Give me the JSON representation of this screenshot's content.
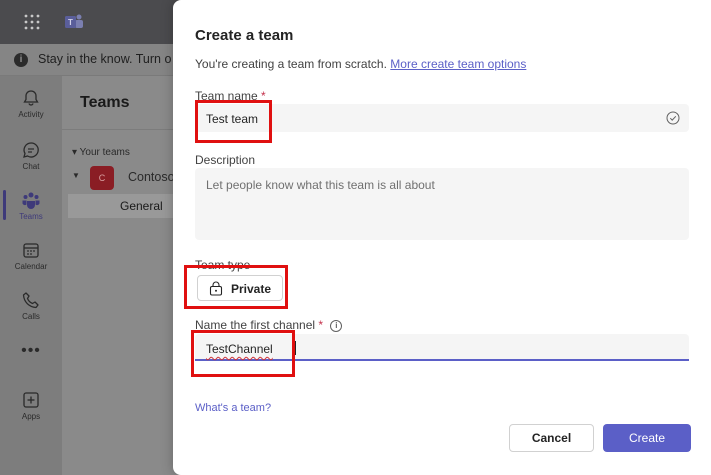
{
  "banner": {
    "text": "Stay in the know. Turn o",
    "icon": "info-icon"
  },
  "rail": {
    "items": [
      {
        "label": "Activity",
        "icon": "bell-icon"
      },
      {
        "label": "Chat",
        "icon": "chat-icon"
      },
      {
        "label": "Teams",
        "icon": "teams-icon",
        "active": true
      },
      {
        "label": "Calendar",
        "icon": "calendar-icon"
      },
      {
        "label": "Calls",
        "icon": "phone-icon"
      },
      {
        "label": "Apps",
        "icon": "apps-icon"
      }
    ],
    "more": "•••"
  },
  "teams_panel": {
    "heading": "Teams",
    "section": "Your teams",
    "team": {
      "initial": "C",
      "name": "Contoso",
      "channel": "General"
    }
  },
  "dialog": {
    "title": "Create a team",
    "subtitle": "You're creating a team from scratch.",
    "subtitle_link": "More create team options",
    "team_name": {
      "label": "Team name",
      "required_mark": "*",
      "value": "Test team"
    },
    "description": {
      "label": "Description",
      "placeholder": "Let people know what this team is all about"
    },
    "team_type": {
      "label": "Team type",
      "value": "Private",
      "icon": "lock-icon"
    },
    "first_channel": {
      "label": "Name the first channel",
      "required_mark": "*",
      "value": "TestChannel",
      "info_glyph": "i"
    },
    "help_link": "What's a team?",
    "cancel_label": "Cancel",
    "create_label": "Create"
  },
  "colors": {
    "accent": "#5b5fc7",
    "highlight": "#e01010",
    "required": "#c4314b"
  }
}
